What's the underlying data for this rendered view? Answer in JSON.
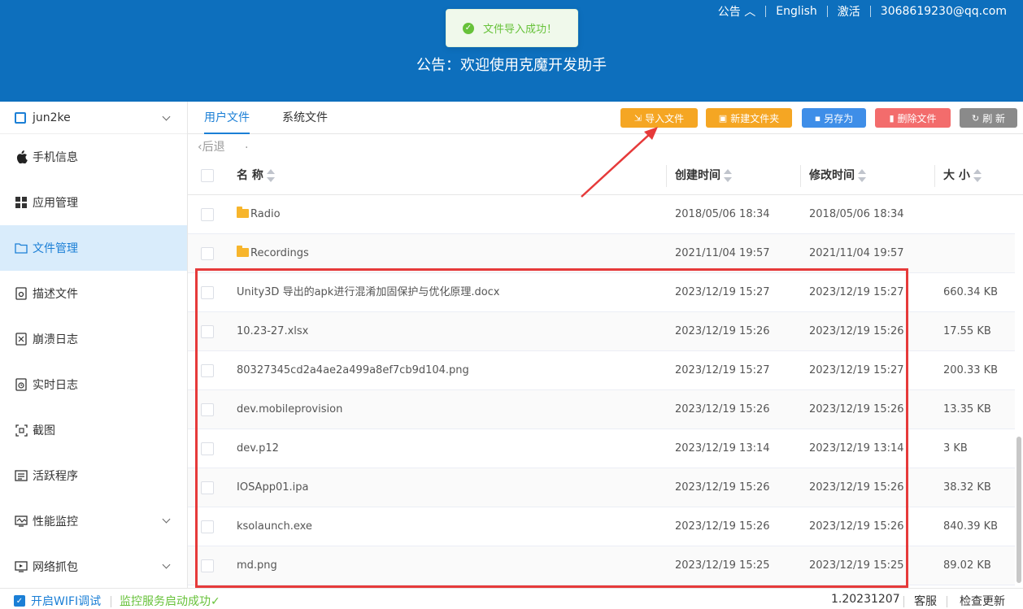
{
  "header": {
    "announcement_link": "公告",
    "language": "English",
    "activate": "激活",
    "account": "3068619230@qq.com",
    "announcement_title": "公告：欢迎使用克魔开发助手"
  },
  "toast": {
    "message": "文件导入成功！",
    "icon": "check-circle-icon"
  },
  "sidebar": {
    "device": "jun2ke",
    "items": [
      {
        "label": "手机信息",
        "icon": "apple-icon"
      },
      {
        "label": "应用管理",
        "icon": "apps-grid-icon"
      },
      {
        "label": "文件管理",
        "icon": "folder-icon",
        "active": true
      },
      {
        "label": "描述文件",
        "icon": "profile-icon"
      },
      {
        "label": "崩溃日志",
        "icon": "crash-log-icon"
      },
      {
        "label": "实时日志",
        "icon": "realtime-log-icon"
      },
      {
        "label": "截图",
        "icon": "screenshot-icon"
      },
      {
        "label": "活跃程序",
        "icon": "active-apps-icon"
      },
      {
        "label": "性能监控",
        "icon": "performance-icon"
      },
      {
        "label": "网络抓包",
        "icon": "network-capture-icon"
      }
    ]
  },
  "tabs": {
    "user_files": "用户文件",
    "system_files": "系统文件"
  },
  "toolbar": {
    "import": "导入文件",
    "new_folder": "新建文件夹",
    "save_as": "另存为",
    "delete": "删除文件",
    "refresh": "刷 新",
    "colors": {
      "import": "#f5a623",
      "new_folder": "#f5a623",
      "save_as": "#3e8ee8",
      "delete": "#f36c6c",
      "refresh": "#8a8a8a"
    }
  },
  "nav": {
    "back": "后退",
    "path": "."
  },
  "table": {
    "headers": {
      "name": "名 称",
      "created": "创建时间",
      "modified": "修改时间",
      "size": "大 小"
    },
    "rows": [
      {
        "name": "Radio",
        "created": "2018/05/06 18:34",
        "modified": "2018/05/06 18:34",
        "size": "",
        "folder": true
      },
      {
        "name": "Recordings",
        "created": "2021/11/04 19:57",
        "modified": "2021/11/04 19:57",
        "size": "",
        "folder": true
      },
      {
        "name": " Unity3D 导出的apk进行混淆加固保护与优化原理.docx",
        "created": "2023/12/19 15:27",
        "modified": "2023/12/19 15:27",
        "size": "660.34 KB"
      },
      {
        "name": "10.23-27.xlsx",
        "created": "2023/12/19 15:26",
        "modified": "2023/12/19 15:26",
        "size": "17.55 KB"
      },
      {
        "name": "80327345cd2a4ae2a499a8ef7cb9d104.png",
        "created": "2023/12/19 15:27",
        "modified": "2023/12/19 15:27",
        "size": "200.33 KB"
      },
      {
        "name": "dev.mobileprovision",
        "created": "2023/12/19 15:26",
        "modified": "2023/12/19 15:26",
        "size": "13.35 KB"
      },
      {
        "name": "dev.p12",
        "created": "2023/12/19 13:14",
        "modified": "2023/12/19 13:14",
        "size": "3 KB"
      },
      {
        "name": "IOSApp01.ipa",
        "created": "2023/12/19 15:26",
        "modified": "2023/12/19 15:26",
        "size": "38.32 KB"
      },
      {
        "name": "ksolaunch.exe",
        "created": "2023/12/19 15:26",
        "modified": "2023/12/19 15:26",
        "size": "840.39 KB"
      },
      {
        "name": "md.png",
        "created": "2023/12/19 15:25",
        "modified": "2023/12/19 15:25",
        "size": "89.02 KB"
      }
    ]
  },
  "footer": {
    "wifi_debug": "开启WIFI调试",
    "monitor_status": "监控服务启动成功",
    "version": "1.20231207",
    "support": "客服",
    "check_update": "检查更新"
  },
  "accent_color": "#0d6fbd"
}
